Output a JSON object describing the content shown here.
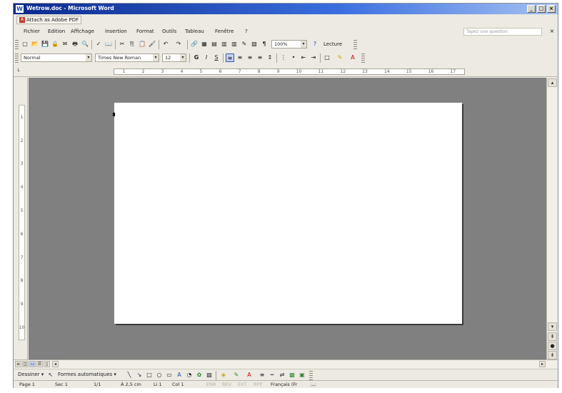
{
  "window": {
    "title": "Wetrow.doc - Microsoft Word",
    "app_icon": "W"
  },
  "title_buttons": {
    "minimize": "_",
    "maximize": "□",
    "close": "×"
  },
  "pdf_toolbar": {
    "label": "Attach as Adobe PDF"
  },
  "menu": {
    "items": [
      "Fichier",
      "Edition",
      "Affichage",
      "Insertion",
      "Format",
      "Outils",
      "Tableau",
      "Fenêtre",
      "?"
    ],
    "ask_placeholder": "Tapez une question",
    "close": "×"
  },
  "standard_toolbar": {
    "zoom": "100%",
    "read_label": "Lecture"
  },
  "formatting_toolbar": {
    "style": "Normal",
    "font": "Times New Roman",
    "size": "12"
  },
  "icons": {
    "new": "▢",
    "open": "📂",
    "save": "💾",
    "permission": "🔒",
    "email": "✉",
    "print": "🖶",
    "preview": "🔍",
    "spelling": "✓",
    "research": "📖",
    "cut": "✂",
    "copy": "⎘",
    "paste": "📋",
    "format_painter": "🖌",
    "undo": "↶",
    "redo": "↷",
    "hyperlink": "🔗",
    "tables": "▦",
    "insert_table": "▤",
    "excel": "▥",
    "columns": "▥",
    "drawing": "✎",
    "doc_map": "▧",
    "show_hide": "¶",
    "help": "?",
    "bold": "G",
    "italic": "I",
    "underline": "S",
    "align_left": "≡",
    "center": "≡",
    "align_right": "≡",
    "justify": "≡",
    "line_spacing": "↕",
    "numbering": "⋮",
    "bullets": "•",
    "decrease_indent": "⇤",
    "increase_indent": "⇥",
    "border": "□",
    "highlight": "✎",
    "font_color": "A",
    "line": "╲",
    "arrow": "↘",
    "rectangle": "□",
    "oval": "○",
    "textbox": "▭",
    "wordart": "A",
    "diagram": "◔",
    "clipart": "✿",
    "picture": "▨",
    "fill": "◈",
    "line_color": "✎",
    "line_style": "≡",
    "dash_style": "┅",
    "arrow_style": "⇄",
    "shadow": "▩",
    "threed": "▣"
  },
  "ruler": {
    "marks": [
      "1",
      "2",
      "3",
      "4",
      "5",
      "6",
      "7",
      "8",
      "9",
      "10",
      "11",
      "12",
      "13",
      "14",
      "15",
      "16",
      "17"
    ]
  },
  "vertical_ruler": {
    "marks": [
      "1",
      "2",
      "3",
      "4",
      "5",
      "6",
      "7",
      "8",
      "9",
      "10"
    ]
  },
  "drawing_toolbar": {
    "draw_label": "Dessiner ▾",
    "autoshapes_label": "Formes automatiques ▾"
  },
  "status": {
    "page": "Page 1",
    "section": "Sec 1",
    "pages": "1/1",
    "position": "À 2,5 cm",
    "line": "Li 1",
    "column": "Col 1",
    "modes": [
      "ENR",
      "REV",
      "EXT",
      "RFP"
    ],
    "language": "Français (Fr"
  }
}
